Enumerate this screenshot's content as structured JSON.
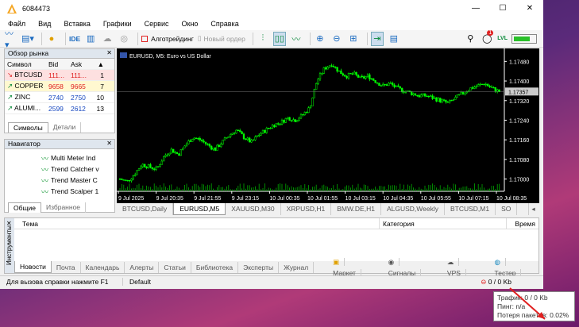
{
  "window": {
    "title": "6084473",
    "controls": [
      "—",
      "☐",
      "✕"
    ]
  },
  "menu": [
    "Файл",
    "Вид",
    "Вставка",
    "Графики",
    "Сервис",
    "Окно",
    "Справка"
  ],
  "toolbar": {
    "ide": "IDE",
    "algo": "Алготрейдинг",
    "new_order": "Новый ордер",
    "badge": "1",
    "lvl": "LVL"
  },
  "market_watch": {
    "title": "Обзор рынка",
    "headers": {
      "symbol": "Символ",
      "bid": "Bid",
      "ask": "Ask",
      "spread": ""
    },
    "rows": [
      {
        "symbol": "BTCUSD",
        "bid": "111...",
        "ask": "111...",
        "spread": "1"
      },
      {
        "symbol": "COPPER",
        "bid": "9658",
        "ask": "9665",
        "spread": "7"
      },
      {
        "symbol": "ZINC",
        "bid": "2740",
        "ask": "2750",
        "spread": "10"
      },
      {
        "symbol": "ALUMI...",
        "bid": "2599",
        "ask": "2612",
        "spread": "13"
      }
    ],
    "tabs": [
      "Символы",
      "Детали"
    ]
  },
  "navigator": {
    "title": "Навигатор",
    "items": [
      "Multi Meter Ind",
      "Trend Catcher v",
      "Trend Master C",
      "Trend Scalper 1"
    ],
    "tabs": [
      "Общие",
      "Избранное"
    ]
  },
  "chart": {
    "label": "EURUSD, M5:  Euro vs US Dollar",
    "price_tag": "1.17357"
  },
  "chart_data": {
    "type": "candlestick",
    "symbol": "EURUSD",
    "timeframe": "M5",
    "title": "EURUSD, M5:  Euro vs US Dollar",
    "yticks": [
      "1.17480",
      "1.17400",
      "1.17320",
      "1.17240",
      "1.17160",
      "1.17080",
      "1.17000"
    ],
    "xticks": [
      "9 Jul 2025",
      "9 Jul 20:35",
      "9 Jul 21:55",
      "9 Jul 23:15",
      "10 Jul 00:35",
      "10 Jul 01:55",
      "10 Jul 03:15",
      "10 Jul 04:35",
      "10 Jul 05:55",
      "10 Jul 07:15",
      "10 Jul 08:35"
    ],
    "ylim": [
      1.1695,
      1.1752
    ],
    "close_path": [
      1.17,
      1.1699,
      1.1702,
      1.1706,
      1.1705,
      1.1704,
      1.1709,
      1.1712,
      1.171,
      1.1714,
      1.1717,
      1.1716,
      1.1714,
      1.1712,
      1.1715,
      1.1718,
      1.172,
      1.1717,
      1.1715,
      1.1718,
      1.172,
      1.1722,
      1.1723,
      1.1725,
      1.1724,
      1.1726,
      1.1729,
      1.174,
      1.1745,
      1.1747,
      1.1744,
      1.1742,
      1.1743,
      1.1741,
      1.1742,
      1.174,
      1.1738,
      1.1739,
      1.1737,
      1.1736,
      1.1735,
      1.1734,
      1.1734,
      1.1733,
      1.1732,
      1.1731,
      1.1733,
      1.1735,
      1.1737,
      1.1738,
      1.1739,
      1.1737,
      1.17357
    ]
  },
  "chart_tabs": [
    "BTCUSD,Daily",
    "EURUSD,M5",
    "XAUUSD,M30",
    "XRPUSD,H1",
    "BMW.DE,H1",
    "ALGUSD,Weekly",
    "BTCUSD,M1",
    "SO"
  ],
  "toolbox": {
    "side_label": "Инструменты",
    "columns": [
      "Тема",
      "Категория",
      "Время"
    ],
    "tabs": [
      "Новости",
      "Почта",
      "Календарь",
      "Алерты",
      "Статьи",
      "Библиотека",
      "Эксперты",
      "Журнал"
    ],
    "right": {
      "market": "Маркет",
      "signals": "Сигналы",
      "vps": "VPS",
      "tester": "Тестер"
    }
  },
  "status": {
    "help": "Для вызова справки нажмите F1",
    "profile": "Default",
    "traffic": "0 / 0 Kb"
  },
  "tooltip": {
    "line1": "Трафик: 0 / 0 Kb",
    "line2": "Пинг: n/a",
    "line3": "Потеря пакетов: 0.02%"
  },
  "colors": {
    "candle": "#00ff00",
    "chart_bg": "#000000",
    "accent": "#e02020",
    "tooltip_arrow": "#e02020"
  }
}
